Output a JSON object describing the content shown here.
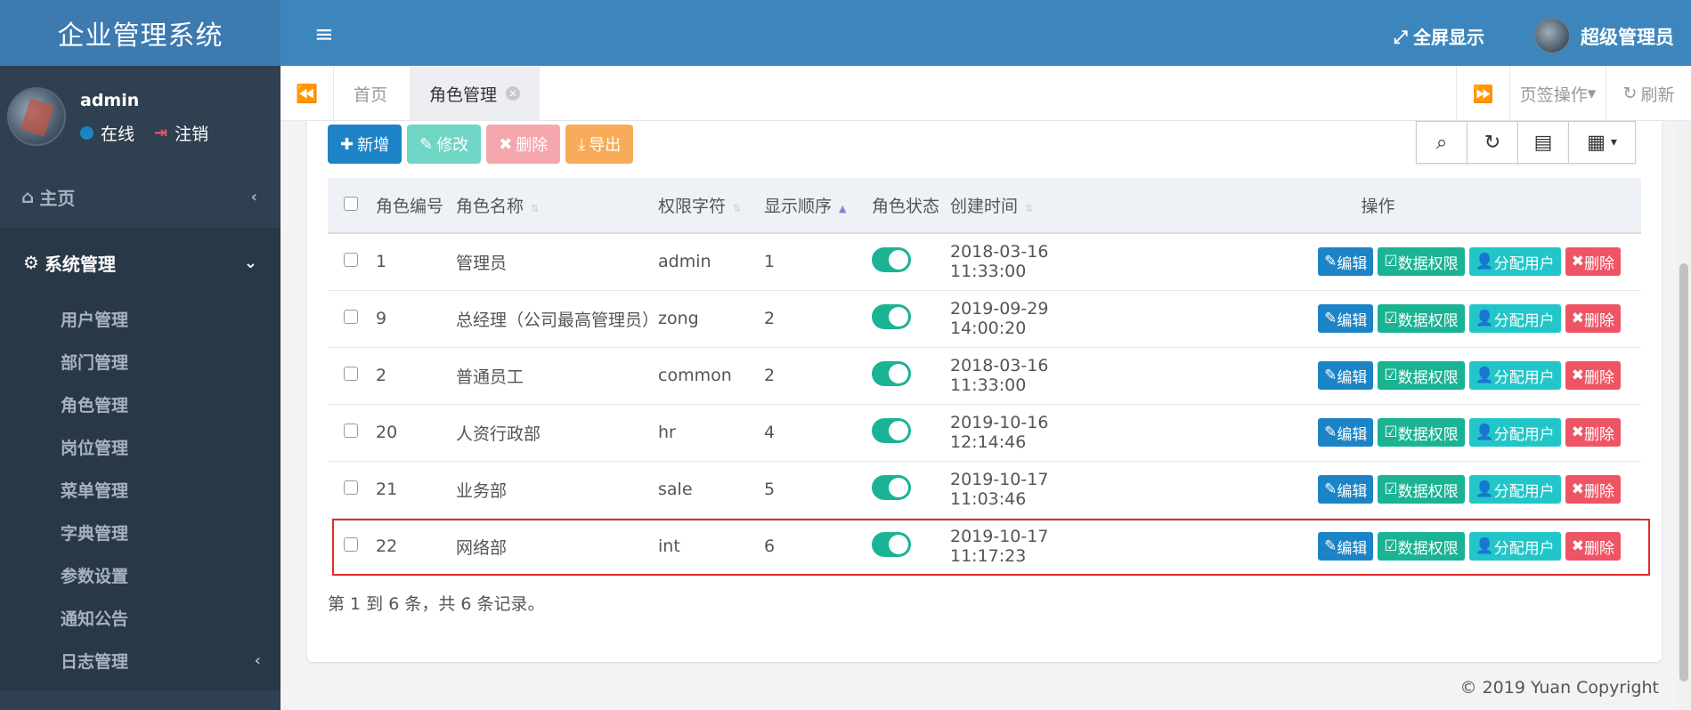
{
  "sidebar": {
    "brand": "企业管理系统",
    "user": {
      "name": "admin",
      "status": "在线",
      "logout": "注销"
    },
    "home": "主页",
    "system": "系统管理",
    "items": [
      "用户管理",
      "部门管理",
      "角色管理",
      "岗位管理",
      "菜单管理",
      "字典管理",
      "参数设置",
      "通知公告",
      "日志管理"
    ]
  },
  "header": {
    "fullscreen": "全屏显示",
    "admin": "超级管理员"
  },
  "tabs": {
    "home": "首页",
    "active": "角色管理",
    "ops": "页签操作",
    "refresh": "刷新"
  },
  "toolbar": {
    "add": "新增",
    "edit": "修改",
    "delete": "删除",
    "export": "导出"
  },
  "table": {
    "headers": [
      "角色编号",
      "角色名称",
      "权限字符",
      "显示顺序",
      "角色状态",
      "创建时间",
      "操作"
    ],
    "rows": [
      {
        "id": "1",
        "name": "管理员",
        "key": "admin",
        "order": "1",
        "created": "2018-03-16 11:33:00"
      },
      {
        "id": "9",
        "name": "总经理（公司最高管理员）",
        "key": "zong",
        "order": "2",
        "created": "2019-09-29 14:00:20"
      },
      {
        "id": "2",
        "name": "普通员工",
        "key": "common",
        "order": "2",
        "created": "2018-03-16 11:33:00"
      },
      {
        "id": "20",
        "name": "人资行政部",
        "key": "hr",
        "order": "4",
        "created": "2019-10-16 12:14:46"
      },
      {
        "id": "21",
        "name": "业务部",
        "key": "sale",
        "order": "5",
        "created": "2019-10-17 11:03:46"
      },
      {
        "id": "22",
        "name": "网络部",
        "key": "int",
        "order": "6",
        "created": "2019-10-17 11:17:23"
      }
    ],
    "row_actions": {
      "edit": "编辑",
      "data": "数据权限",
      "assign": "分配用户",
      "delete": "删除"
    },
    "summary": "第 1 到 6 条，共 6 条记录。"
  },
  "footer": "© 2019 Yuan Copyright",
  "colors": {
    "sidebar": "#2f4050",
    "header": "#3c86bd",
    "primary": "#1c84c6",
    "success": "#1ab394",
    "info": "#23c6c8",
    "danger": "#ed5565",
    "warning": "#f8ac59"
  }
}
